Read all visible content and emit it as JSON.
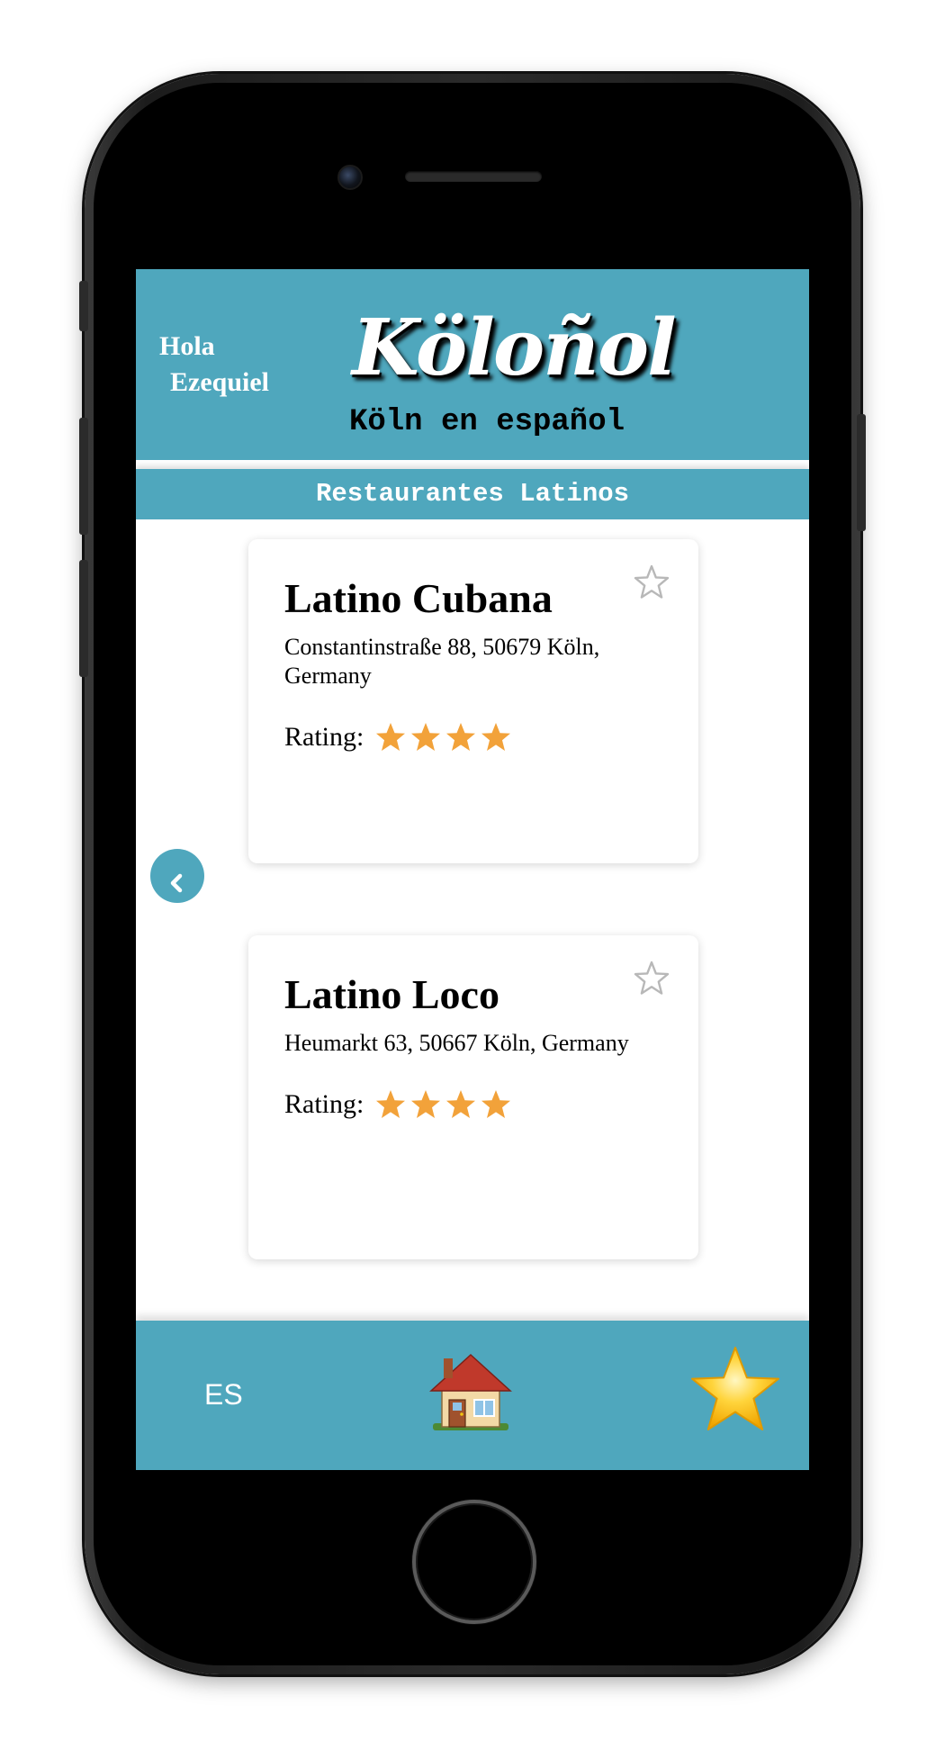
{
  "header": {
    "greeting_line1": "Hola",
    "greeting_line2": "Ezequiel",
    "logo_text": "Köloñol",
    "tagline": "Köln en español"
  },
  "section": {
    "title": "Restaurantes Latinos"
  },
  "restaurants": [
    {
      "name": "Latino Cubana",
      "address": "Constantinstraße 88, 50679 Köln, Germany",
      "rating_label": "Rating:",
      "rating": 4,
      "favorite": false
    },
    {
      "name": "Latino Loco",
      "address": "Heumarkt 63, 50667 Köln, Germany",
      "rating_label": "Rating:",
      "rating": 4,
      "favorite": false
    }
  ],
  "footer": {
    "language": "ES",
    "home_icon": "house-icon",
    "favorites_icon": "star-icon"
  },
  "colors": {
    "brand": "#4fa7bd",
    "rating_star": "#f2a23a",
    "favorite_outline": "#b8b8b8"
  }
}
